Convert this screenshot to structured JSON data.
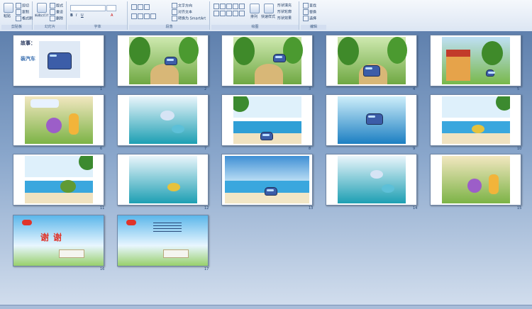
{
  "ribbon": {
    "groups": [
      {
        "label": "剪贴板",
        "buttons": [
          "粘贴",
          "剪切",
          "复制",
          "格式刷"
        ]
      },
      {
        "label": "幻灯片",
        "buttons": [
          "新建幻灯片",
          "版式",
          "重设",
          "删除"
        ]
      },
      {
        "label": "字体",
        "buttons": []
      },
      {
        "label": "段落",
        "buttons": [
          "文字方向",
          "对齐文本",
          "转换为 SmartArt"
        ]
      },
      {
        "label": "绘图",
        "buttons": [
          "排列",
          "快速样式",
          "形状填充",
          "形状轮廓",
          "形状效果"
        ]
      },
      {
        "label": "编辑",
        "buttons": [
          "查找",
          "替换",
          "选择"
        ]
      }
    ]
  },
  "slides": [
    {
      "num": "1",
      "title": "故事：",
      "title2": "装汽车"
    },
    {
      "num": "2"
    },
    {
      "num": "3"
    },
    {
      "num": "4"
    },
    {
      "num": "5"
    },
    {
      "num": "6"
    },
    {
      "num": "7"
    },
    {
      "num": "8"
    },
    {
      "num": "9"
    },
    {
      "num": "10"
    },
    {
      "num": "11"
    },
    {
      "num": "12"
    },
    {
      "num": "13"
    },
    {
      "num": "14"
    },
    {
      "num": "15"
    },
    {
      "num": "16",
      "thanks": "谢谢"
    },
    {
      "num": "17"
    }
  ],
  "colors": {
    "ribbon_bg": "#dce6f3",
    "canvas_top": "#5f80ad",
    "accent": "#e0342a"
  }
}
